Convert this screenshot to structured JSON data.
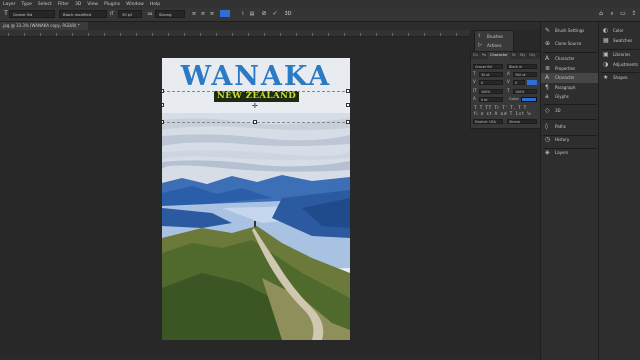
{
  "menu": [
    "Layer",
    "Type",
    "Select",
    "Filter",
    "3D",
    "View",
    "Plugins",
    "Window",
    "Help"
  ],
  "options": {
    "font_family": "Graver Bd",
    "font_style": "Black modified",
    "font_size": "30 pt",
    "anti_alias": "Strong"
  },
  "document_tab": ".jpg @ 33.3% (WANAKA copy, RGB/8) *",
  "poster": {
    "title": "WANAKA",
    "subtitle": "NEW ZEALAND"
  },
  "floating_panel": {
    "items": [
      "Brushes",
      "Actions"
    ]
  },
  "character_panel": {
    "tabs": [
      "Ch",
      "Pa",
      "Character",
      "Te",
      "Sty",
      "Gly"
    ],
    "font_family": "Graver Bd",
    "font_style": "Black m",
    "size": "30 pt",
    "leading": "300 pt",
    "kerning": "0",
    "tracking": "0",
    "vscale": "100%",
    "hscale": "100%",
    "baseline": "0 pt",
    "color_label": "Color:",
    "language": "English: USA",
    "aa": "Strong"
  },
  "dock1": [
    "Brush Settings",
    "Clone Source",
    "Character",
    "Properties",
    "Character",
    "Paragraph",
    "Glyphs",
    "3D",
    "Paths",
    "History",
    "Layers"
  ],
  "dock2": [
    "Color",
    "Swatches",
    "Libraries",
    "Adjustments",
    "Shapes"
  ],
  "colors": {
    "title_blue": "#2a7bc4",
    "subtitle_green": "#c8e034",
    "accent_blue": "#2d6fd4"
  }
}
